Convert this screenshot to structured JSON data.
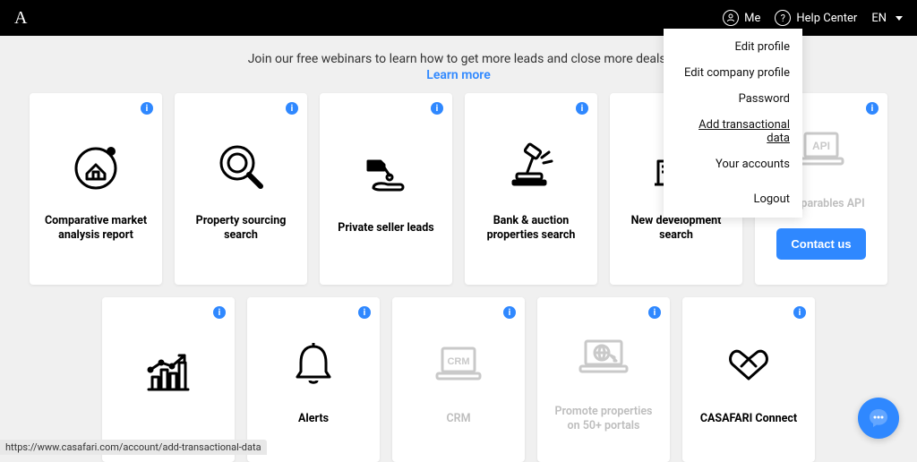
{
  "topbar": {
    "logo": "A",
    "me": "Me",
    "help": "Help Center",
    "lang": "EN"
  },
  "dropdown": {
    "items": [
      "Edit profile",
      "Edit company profile",
      "Password",
      "Add transactional data",
      "Your accounts"
    ],
    "logout": "Logout"
  },
  "banner": {
    "text": "Join our free webinars to learn how to get more leads and close more deals!",
    "link": "Learn more"
  },
  "cards": {
    "cma": "Comparative market analysis report",
    "sourcing": "Property sourcing search",
    "private": "Private seller leads",
    "bank": "Bank & auction properties search",
    "newdev": "New development search",
    "api": "Comparables API",
    "contact": "Contact us",
    "alerts": "Alerts",
    "crm": "CRM",
    "promote": "Promote properties on 50+ portals",
    "connect": "CASAFARI Connect"
  },
  "status_url": "https://www.casafari.com/account/add-transactional-data"
}
